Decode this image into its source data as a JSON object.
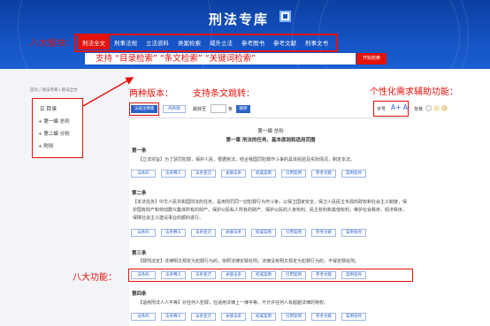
{
  "header": {
    "logo_text": "刑法专库",
    "nav": [
      "刑法全文",
      "刑事法规",
      "立法资料",
      "类案检索",
      "域外立法",
      "参考图书",
      "参考文献",
      "刑事文书"
    ],
    "search_button": "开始检索"
  },
  "annotations": {
    "eight_sections": "八大板块：",
    "search_support": "支持 “目录检索”  “条文检索”  “关键词检索”",
    "two_versions": "两种版本：",
    "jump": "支持条文跳转：",
    "personal": "个性化需求辅助功能：",
    "eight_functions": "八大功能："
  },
  "breadcrumb": "首页 / 刑法专库 / 刑法全文",
  "toc": {
    "title": "目录",
    "items": [
      "第一编  总则",
      "第二编  分则",
      "附则"
    ]
  },
  "toolbar": {
    "version_a": "法规注释版",
    "version_b": "纯条版",
    "jump_label": "跳转至",
    "jump_unit": "条",
    "jump_button": "跳转",
    "font_label": "字号",
    "font_icon": "A+ A-",
    "bg_label": "背景"
  },
  "content": {
    "part_title": "第一编  总则",
    "chapter_title": "第一章  刑法的任务、基本原则和适用范围",
    "articles": [
      {
        "num": "第一条",
        "text": "【立法宗旨】为了惩罚犯罪，保护人民，根据宪法，结合我国同犯罪作斗争的具体经验及实际情况，制定本法。"
      },
      {
        "num": "第二条",
        "text": "【本法任务】中华人民共和国刑法的任务，是用刑罚同一切犯罪行为作斗争，以保卫国家安全，保卫人民民主专政的政权和社会主义制度，保护国有财产和劳动群众集体所有的财产，保护公民私人所有的财产，保护公民的人身权利、民主权利和其他权利，维护社会秩序、经济秩序，保障社会主义建设事业的顺利进行。"
      },
      {
        "num": "第三条",
        "text": "【罪刑法定】法律明文规定为犯罪行为的，依照法律定罪处刑；法律没有明文规定为犯罪行为的，不得定罪处刑。"
      },
      {
        "num": "第四条",
        "text": "【适用刑法人人平等】对任何人犯罪，在适用法律上一律平等。不允许任何人有超越法律的特权。"
      }
    ],
    "functions": [
      "法条码",
      "法条释义",
      "法条变迁",
      "关联法条",
      "权威案例",
      "引用案例",
      "参考文献",
      "案例指导"
    ]
  }
}
